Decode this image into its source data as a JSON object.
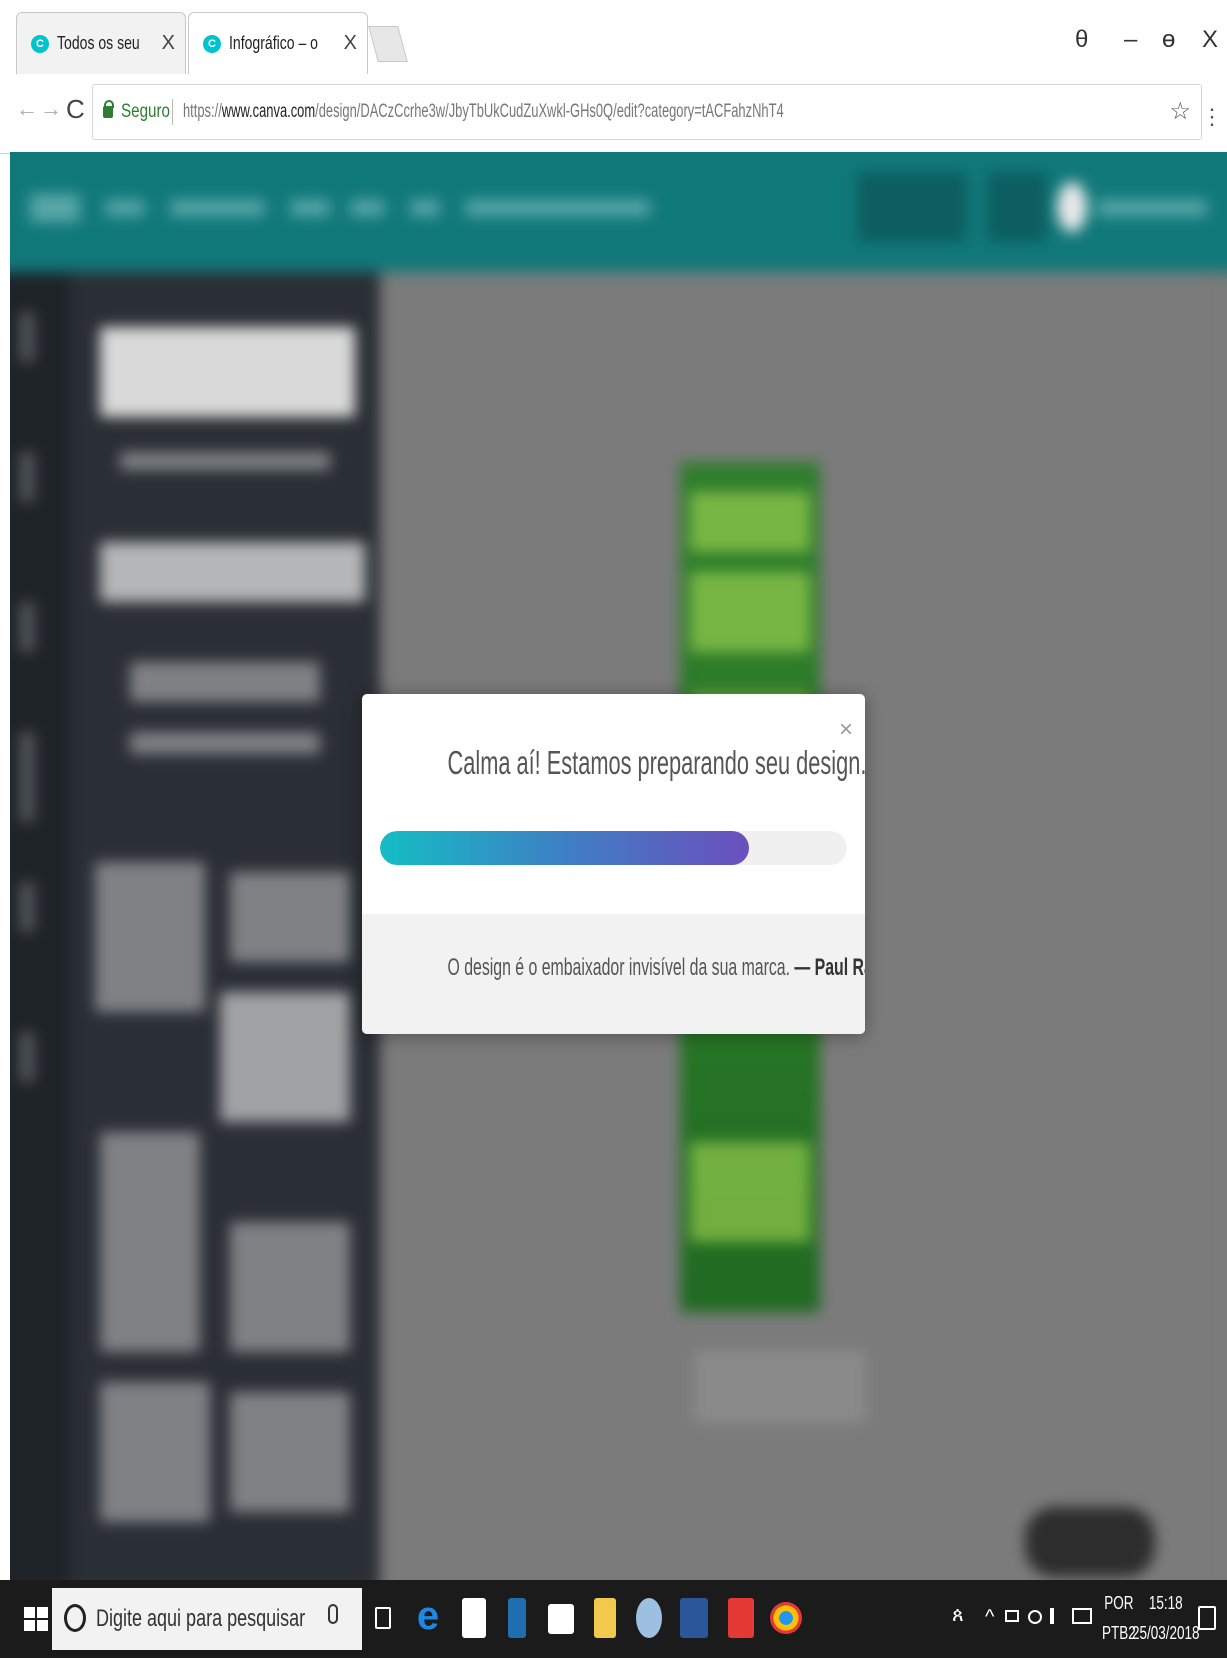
{
  "browser": {
    "tabs": [
      {
        "title": "Todos os seus designs -",
        "close": "X",
        "favicon": "C",
        "active": false
      },
      {
        "title": "Infográfico – o",
        "close": "X",
        "favicon": "C",
        "active": true
      }
    ],
    "window_controls": {
      "profile": "θ",
      "minimize": "–",
      "restore": "ɵ",
      "close": "X"
    },
    "nav": {
      "back": "←",
      "forward": "→",
      "reload": "C"
    },
    "address_bar": {
      "secure_label": "Seguro",
      "url_scheme": "https://",
      "url_host": "www.canva.com",
      "url_path": "/design/DACzCcrhe3w/JbyTbUkCudZuXwkl-GHs0Q/edit?category=tACFahzNhT4"
    },
    "star": "☆",
    "menu": "⋮"
  },
  "modal": {
    "title": "Calma aí! Estamos preparando seu design...",
    "close": "×",
    "progress_fraction": 0.79,
    "quote_text": "O design é o embaixador invisível da sua marca.",
    "quote_author": "— Paul Rand"
  },
  "taskbar": {
    "search_placeholder": "Digite aqui para pesquisar",
    "apps": [
      "edge-icon",
      "store-icon",
      "app-icon",
      "mail-icon",
      "file-explorer-icon",
      "media-icon",
      "word-icon",
      "acrobat-icon",
      "chrome-icon"
    ],
    "tray": {
      "people": "ጰ",
      "chevron": "^",
      "lang_top": "POR",
      "lang_bottom": "PTB2",
      "time": "15:18",
      "date": "25/03/2018"
    }
  },
  "colors": {
    "canva_teal": "#11787a",
    "progress_start": "#14bdc4",
    "progress_end": "#6b4fbd",
    "secure_green": "#2e7d32"
  }
}
